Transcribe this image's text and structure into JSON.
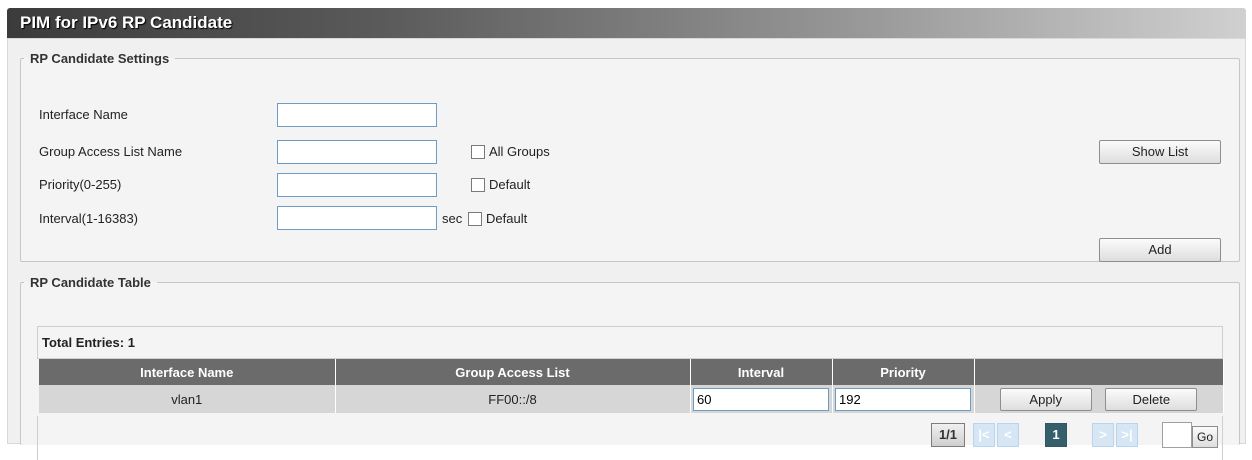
{
  "page": {
    "title": "PIM for IPv6 RP Candidate"
  },
  "settings": {
    "legend": "RP Candidate Settings",
    "interface_name": {
      "label": "Interface Name",
      "value": ""
    },
    "group_access_list": {
      "label": "Group Access List Name",
      "value": "",
      "checkbox_label": "All Groups",
      "checked": false
    },
    "priority": {
      "label": "Priority(0-255)",
      "value": "",
      "checkbox_label": "Default",
      "checked": false
    },
    "interval": {
      "label": "Interval(1-16383)",
      "value": "",
      "unit": "sec",
      "checkbox_label": "Default",
      "checked": false
    },
    "show_list_button": "Show List",
    "add_button": "Add"
  },
  "table": {
    "legend": "RP Candidate Table",
    "total_entries": "Total Entries: 1",
    "columns": [
      "Interface Name",
      "Group Access List",
      "Interval",
      "Priority",
      ""
    ],
    "rows": [
      {
        "interface_name": "vlan1",
        "group_access_list": "FF00::/8",
        "interval": "60",
        "priority": "192",
        "apply_label": "Apply",
        "delete_label": "Delete"
      }
    ]
  },
  "pagination": {
    "page_count": "1/1",
    "first": "|<",
    "prev": "<",
    "current": "1",
    "next": ">",
    "last": ">|",
    "goto_value": "",
    "go_label": "Go"
  }
}
